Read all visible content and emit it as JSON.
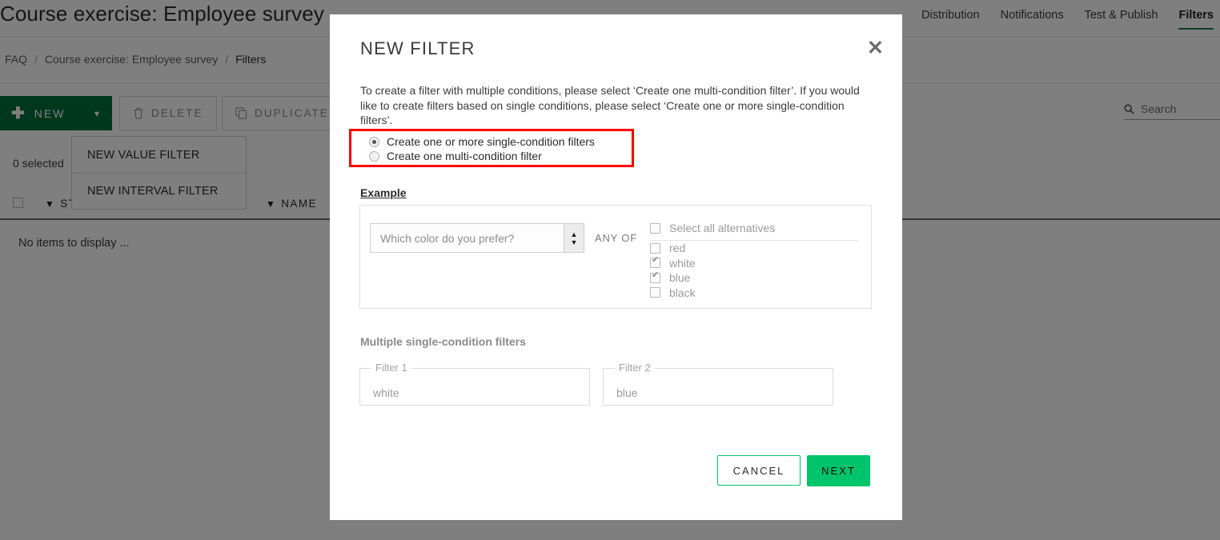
{
  "header": {
    "page_title": "Course exercise: Employee survey",
    "nav_tabs": [
      {
        "label": "Distribution",
        "active": false
      },
      {
        "label": "Notifications",
        "active": false
      },
      {
        "label": "Test & Publish",
        "active": false
      },
      {
        "label": "Filters",
        "active": true
      }
    ],
    "accent_color": "#1a7a46"
  },
  "breadcrumb": {
    "items": [
      "FAQ",
      "Course exercise: Employee survey",
      "Filters"
    ],
    "separator": "/"
  },
  "toolbar": {
    "new_label": "NEW",
    "new_plus_icon": "plus-icon",
    "new_caret_icon": "chevron-down-icon",
    "delete_label": "DELETE",
    "delete_icon": "trash-icon",
    "duplicate_label": "DUPLICATE",
    "duplicate_icon": "copy-icon",
    "new_button_color": "#00703c"
  },
  "new_menu": {
    "items": [
      "NEW VALUE FILTER",
      "NEW INTERVAL FILTER"
    ]
  },
  "search": {
    "icon": "search-icon",
    "placeholder": "Search"
  },
  "table": {
    "selected_text": "0 selected",
    "columns": [
      "STATUS",
      "NAME"
    ],
    "filter_icon": "funnel-icon",
    "empty_text": "No items to display ..."
  },
  "modal": {
    "title": "NEW FILTER",
    "close_icon": "close-icon",
    "description": "To create a filter with multiple conditions, please select ‘Create one multi-condition filter’. If you would like to create filters based on single conditions, please select ‘Create one or more single-condition filters’.",
    "radio_options": [
      {
        "label": "Create one or more single-condition filters",
        "selected": true
      },
      {
        "label": "Create one multi-condition filter",
        "selected": false
      }
    ],
    "highlight_color": "#ff0000",
    "example_link": "Example",
    "example": {
      "question_placeholder": "Which color do you prefer?",
      "spinner_up_icon": "caret-up-icon",
      "spinner_down_icon": "caret-down-icon",
      "operator": "ANY OF",
      "select_all_label": "Select all alternatives",
      "select_all_checked": false,
      "alternatives": [
        {
          "label": "red",
          "checked": false
        },
        {
          "label": "white",
          "checked": true
        },
        {
          "label": "blue",
          "checked": true
        },
        {
          "label": "black",
          "checked": false
        }
      ]
    },
    "result_label": "Multiple single-condition filters",
    "result_fields": [
      {
        "legend": "Filter 1",
        "value": "white"
      },
      {
        "legend": "Filter 2",
        "value": "blue"
      }
    ],
    "cancel_label": "CANCEL",
    "next_label": "NEXT",
    "primary_color": "#00c46a"
  }
}
